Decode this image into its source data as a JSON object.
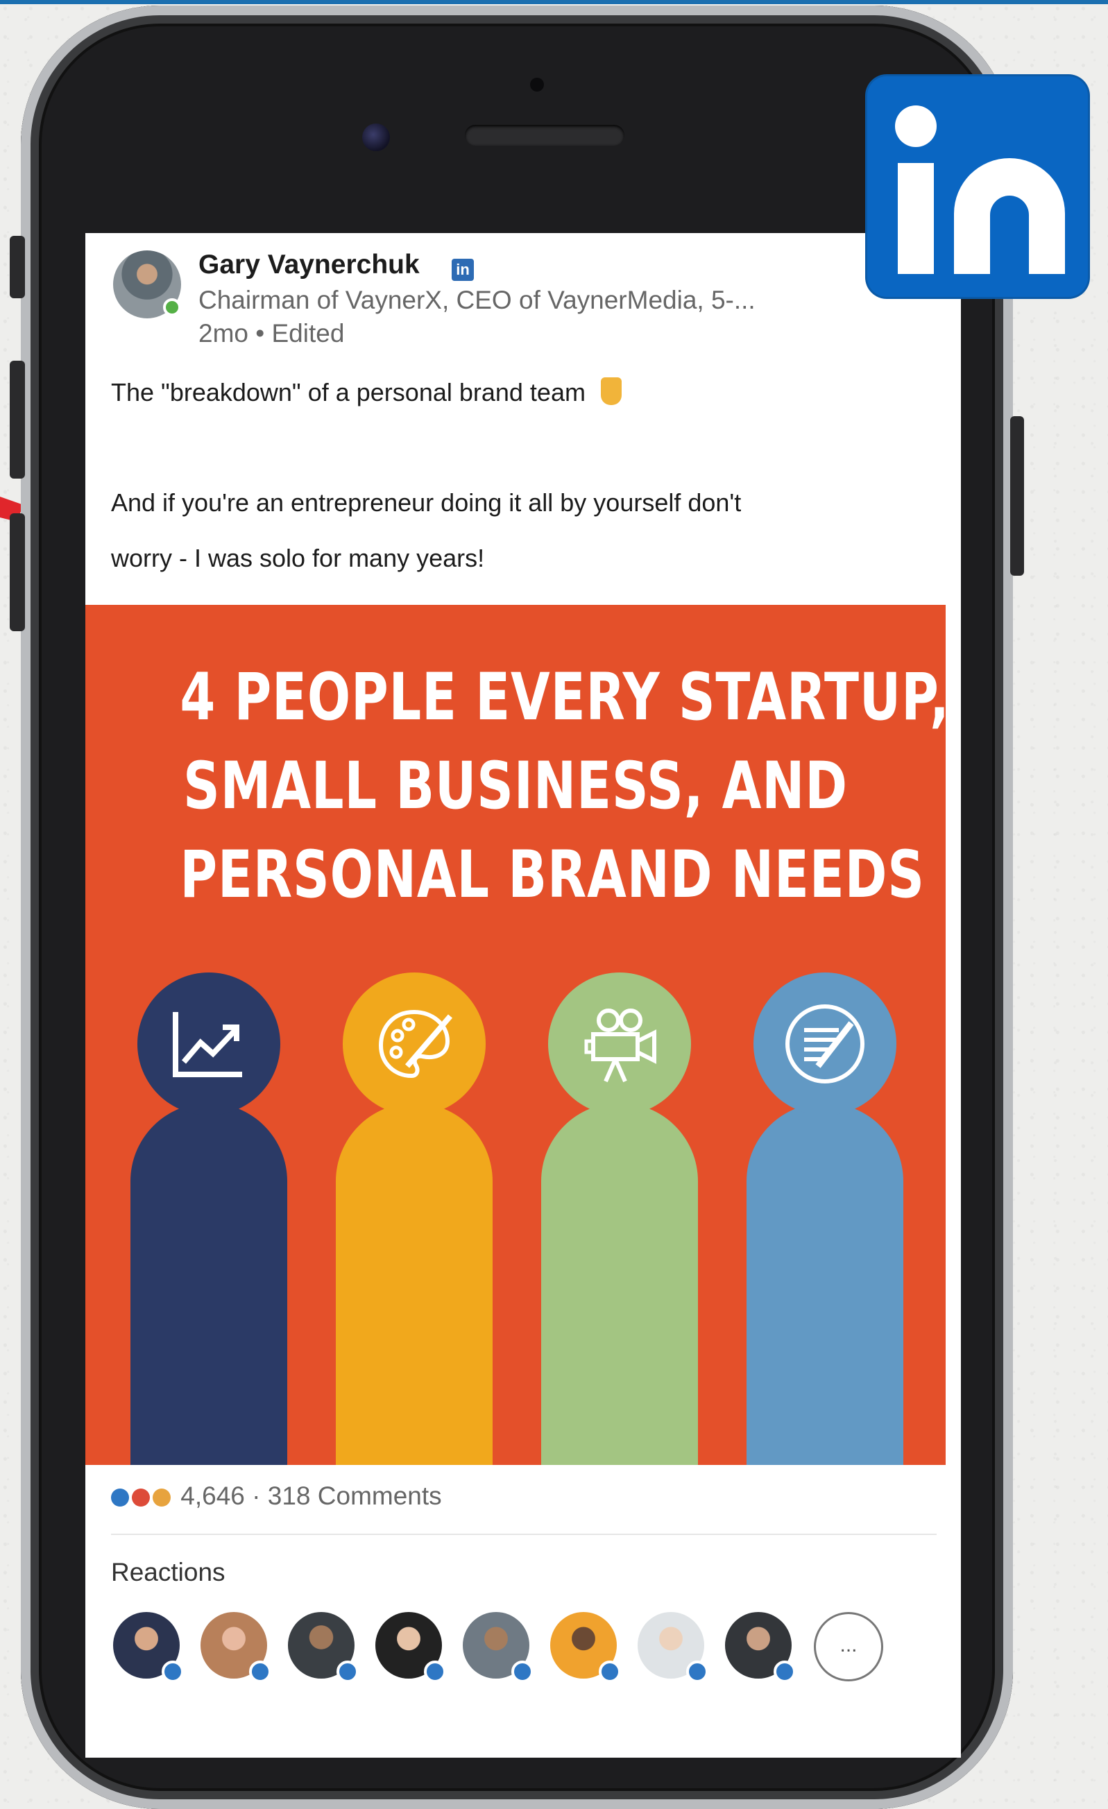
{
  "colors": {
    "linkedin_blue": "#0a66c2",
    "graphic_bg": "#e4502a",
    "person_navy": "#2b3a66",
    "person_yellow": "#f1a81c",
    "person_green": "#a3c582",
    "person_blue": "#6299c4"
  },
  "post": {
    "author": "Gary Vaynerchuk",
    "headline": "Chairman of VaynerX, CEO of VaynerMedia, 5-...",
    "meta": "2mo • Edited",
    "text_line1": "The \"breakdown\" of a personal brand team",
    "text_line2": "And if you're an entrepreneur doing it all by yourself don't",
    "text_line3": "worry - I was solo for many years!",
    "graphic": {
      "title_lines": [
        "4 PEOPLE EVERY STARTUP,",
        "SMALL BUSINESS, AND",
        "PERSONAL BRAND NEEDS"
      ],
      "people_icons": [
        "chart-icon",
        "palette-icon",
        "video-camera-icon",
        "writing-icon"
      ]
    },
    "reactions_count": "4,646",
    "comments_count": "318 Comments",
    "stats_separator": "·",
    "reactions_label": "Reactions",
    "more_reactors": "..."
  }
}
